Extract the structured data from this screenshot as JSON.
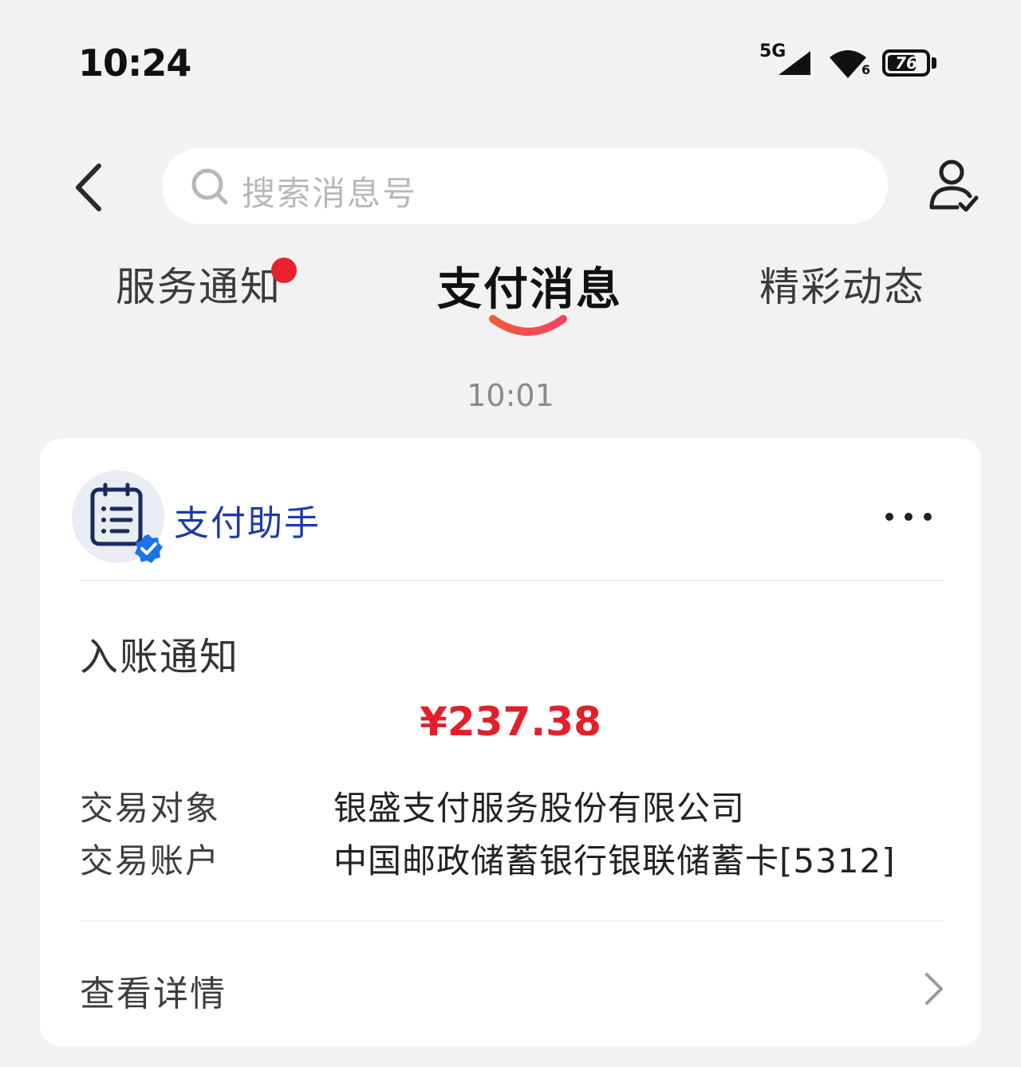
{
  "status_bar": {
    "time": "10:24",
    "network": "5G",
    "wifi_level": "6",
    "battery_level": "76"
  },
  "header": {
    "search_placeholder": "搜索消息号",
    "back_icon": "chevron-left-icon",
    "user_icon": "user-check-icon"
  },
  "tabs": [
    {
      "label": "服务通知",
      "has_badge": true,
      "active": false
    },
    {
      "label": "支付消息",
      "active": true
    },
    {
      "label": "精彩动态",
      "active": false
    }
  ],
  "message": {
    "time": "10:01",
    "sender": {
      "name": "支付助手",
      "avatar_icon": "clipboard-list-icon",
      "verified": true
    },
    "title": "入账通知",
    "amount": "¥237.38",
    "rows": [
      {
        "label": "交易对象",
        "value": "银盛支付服务股份有限公司"
      },
      {
        "label": "交易账户",
        "value": "中国邮政储蓄银行银联储蓄卡[5312]"
      }
    ],
    "details_label": "查看详情"
  },
  "colors": {
    "background": "#f2f2f2",
    "accent_red": "#e3202a",
    "sender_blue": "#1c3aa8",
    "badge_blue": "#1a73e8"
  }
}
